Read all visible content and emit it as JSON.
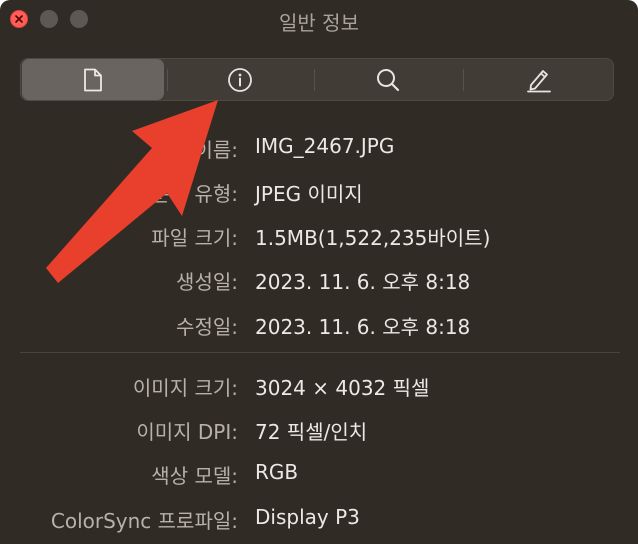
{
  "window": {
    "title": "일반 정보"
  },
  "toolbar": {
    "tabs": [
      {
        "icon": "document-icon",
        "active": true
      },
      {
        "icon": "info-icon",
        "active": false
      },
      {
        "icon": "search-icon",
        "active": false
      },
      {
        "icon": "pencil-icon",
        "active": false
      }
    ]
  },
  "general": {
    "file_name_label": "파일 이름:",
    "file_name": "IMG_2467.JPG",
    "kind_label": "문서 유형:",
    "kind": "JPEG 이미지",
    "size_label": "파일 크기:",
    "size": "1.5MB(1,522,235바이트)",
    "created_label": "생성일:",
    "created": "2023. 11. 6. 오후 8:18",
    "modified_label": "수정일:",
    "modified": "2023. 11. 6. 오후 8:18"
  },
  "image": {
    "dimensions_label": "이미지 크기:",
    "dimensions": "3024 × 4032 픽셀",
    "dpi_label": "이미지 DPI:",
    "dpi": "72 픽셀/인치",
    "color_model_label": "색상 모델:",
    "color_model": "RGB",
    "colorsync_label": "ColorSync 프로파일:",
    "colorsync": "Display P3"
  },
  "colors": {
    "window_bg": "#312b26",
    "close_button": "#ff5f57",
    "annotation_arrow": "#e8402d"
  }
}
